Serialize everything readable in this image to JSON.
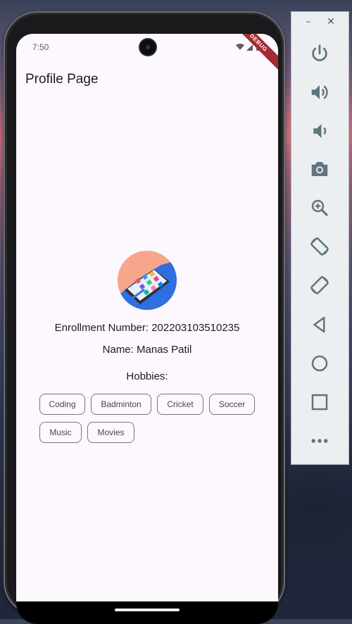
{
  "status_bar": {
    "time": "7:50",
    "debug_label": "DEBUG"
  },
  "app_bar": {
    "title": "Profile Page"
  },
  "profile": {
    "avatar_icon": "smartphone-apps-illustration",
    "enrollment_line": "Enrollment Number: 202203103510235",
    "name_line": "Name: Manas Patil",
    "hobbies_label": "Hobbies:",
    "hobbies": [
      "Coding",
      "Badminton",
      "Cricket",
      "Soccer",
      "Music",
      "Movies"
    ]
  },
  "emulator_panel": {
    "window_controls": {
      "minimize": "–",
      "close": "✕"
    },
    "tools": [
      {
        "icon": "power-icon"
      },
      {
        "icon": "volume-up-icon"
      },
      {
        "icon": "volume-down-icon"
      },
      {
        "icon": "camera-icon"
      },
      {
        "icon": "zoom-in-icon"
      },
      {
        "icon": "rotate-left-icon"
      },
      {
        "icon": "rotate-right-icon"
      },
      {
        "icon": "back-icon"
      },
      {
        "icon": "home-icon"
      },
      {
        "icon": "overview-icon"
      },
      {
        "icon": "more-icon"
      }
    ]
  },
  "colors": {
    "screen_background": "#fdf7fe",
    "chip_border": "#79747e",
    "panel_icon": "#5f7580",
    "debug_ribbon": "#a52a33"
  }
}
